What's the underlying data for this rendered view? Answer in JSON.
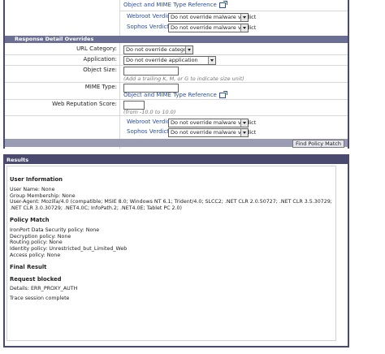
{
  "top": {
    "reference_link": "Object and MIME Type Reference",
    "webroot_label": "Webroot Verdict:",
    "webroot_value": "Do not override malware verdict",
    "sophos_label": "Sophos Verdict:",
    "sophos_value": "Do not override malware verdict"
  },
  "response_section": {
    "title": "Response Detail Overrides",
    "url_category_label": "URL Category:",
    "url_category_value": "Do not override category",
    "application_label": "Application:",
    "application_value": "Do not override application",
    "object_size_label": "Object Size:",
    "object_size_value": "",
    "object_size_hint": "(Add a trailing K, M, or G to indicate size unit)",
    "mime_type_label": "MIME Type:",
    "mime_type_value": "",
    "reference_link": "Object and MIME Type Reference",
    "web_rep_label": "Web Reputation Score:",
    "web_rep_value": "",
    "web_rep_hint": "(from -10.0 to 10.0)",
    "webroot_label": "Webroot Verdict:",
    "webroot_value": "Do not override malware verdict",
    "sophos_label": "Sophos Verdict:",
    "sophos_value": "Do not override malware verdict",
    "find_button": "Find Policy Match"
  },
  "results": {
    "header": "Results",
    "user_info_title": "User Information",
    "user_name": "User Name: None",
    "group_membership": "Group Membership: None",
    "user_agent": "User-Agent: Mozilla/4.0 (compatible; MSIE 8.0; Windows NT 6.1; Trident/4.0; SLCC2; .NET CLR 2.0.50727; .NET CLR 3.5.30729; .NET CLR 3.0.30729; .NET4.0C; InfoPath.2; .NET4.0E; Tablet PC 2.0)",
    "policy_match_title": "Policy Match",
    "ironport_policy": "IronPort Data Security policy: None",
    "decryption_policy": "Decryption policy: None",
    "routing_policy": "Routing policy: None",
    "identity_policy": "Identity policy: Unrestricted_but_Limited_Web",
    "access_policy": "Access policy: None",
    "final_result_title": "Final Result",
    "request_blocked": "Request blocked",
    "details": "Details: ERR_PROXY_AUTH",
    "trace": "Trace session complete"
  }
}
